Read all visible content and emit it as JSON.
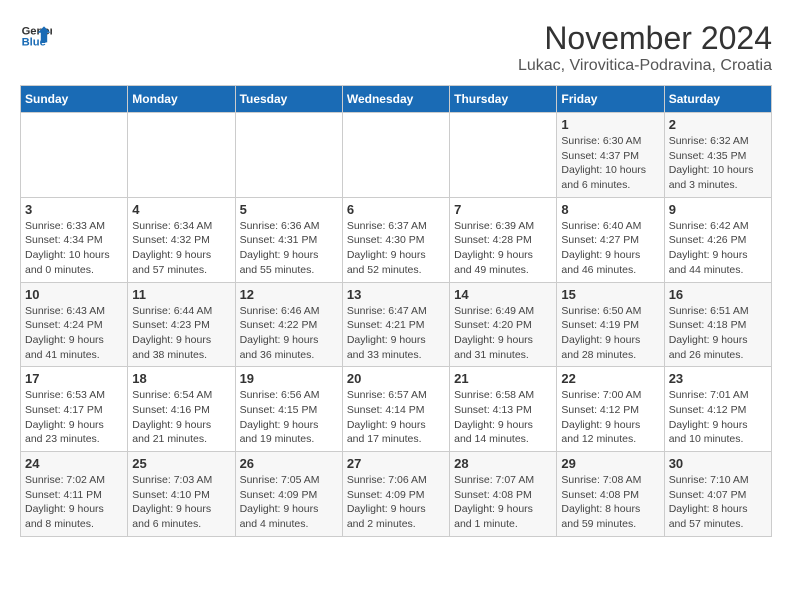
{
  "logo": {
    "line1": "General",
    "line2": "Blue"
  },
  "title": "November 2024",
  "subtitle": "Lukac, Virovitica-Podravina, Croatia",
  "weekdays": [
    "Sunday",
    "Monday",
    "Tuesday",
    "Wednesday",
    "Thursday",
    "Friday",
    "Saturday"
  ],
  "weeks": [
    [
      {
        "day": "",
        "info": ""
      },
      {
        "day": "",
        "info": ""
      },
      {
        "day": "",
        "info": ""
      },
      {
        "day": "",
        "info": ""
      },
      {
        "day": "",
        "info": ""
      },
      {
        "day": "1",
        "info": "Sunrise: 6:30 AM\nSunset: 4:37 PM\nDaylight: 10 hours\nand 6 minutes."
      },
      {
        "day": "2",
        "info": "Sunrise: 6:32 AM\nSunset: 4:35 PM\nDaylight: 10 hours\nand 3 minutes."
      }
    ],
    [
      {
        "day": "3",
        "info": "Sunrise: 6:33 AM\nSunset: 4:34 PM\nDaylight: 10 hours\nand 0 minutes."
      },
      {
        "day": "4",
        "info": "Sunrise: 6:34 AM\nSunset: 4:32 PM\nDaylight: 9 hours\nand 57 minutes."
      },
      {
        "day": "5",
        "info": "Sunrise: 6:36 AM\nSunset: 4:31 PM\nDaylight: 9 hours\nand 55 minutes."
      },
      {
        "day": "6",
        "info": "Sunrise: 6:37 AM\nSunset: 4:30 PM\nDaylight: 9 hours\nand 52 minutes."
      },
      {
        "day": "7",
        "info": "Sunrise: 6:39 AM\nSunset: 4:28 PM\nDaylight: 9 hours\nand 49 minutes."
      },
      {
        "day": "8",
        "info": "Sunrise: 6:40 AM\nSunset: 4:27 PM\nDaylight: 9 hours\nand 46 minutes."
      },
      {
        "day": "9",
        "info": "Sunrise: 6:42 AM\nSunset: 4:26 PM\nDaylight: 9 hours\nand 44 minutes."
      }
    ],
    [
      {
        "day": "10",
        "info": "Sunrise: 6:43 AM\nSunset: 4:24 PM\nDaylight: 9 hours\nand 41 minutes."
      },
      {
        "day": "11",
        "info": "Sunrise: 6:44 AM\nSunset: 4:23 PM\nDaylight: 9 hours\nand 38 minutes."
      },
      {
        "day": "12",
        "info": "Sunrise: 6:46 AM\nSunset: 4:22 PM\nDaylight: 9 hours\nand 36 minutes."
      },
      {
        "day": "13",
        "info": "Sunrise: 6:47 AM\nSunset: 4:21 PM\nDaylight: 9 hours\nand 33 minutes."
      },
      {
        "day": "14",
        "info": "Sunrise: 6:49 AM\nSunset: 4:20 PM\nDaylight: 9 hours\nand 31 minutes."
      },
      {
        "day": "15",
        "info": "Sunrise: 6:50 AM\nSunset: 4:19 PM\nDaylight: 9 hours\nand 28 minutes."
      },
      {
        "day": "16",
        "info": "Sunrise: 6:51 AM\nSunset: 4:18 PM\nDaylight: 9 hours\nand 26 minutes."
      }
    ],
    [
      {
        "day": "17",
        "info": "Sunrise: 6:53 AM\nSunset: 4:17 PM\nDaylight: 9 hours\nand 23 minutes."
      },
      {
        "day": "18",
        "info": "Sunrise: 6:54 AM\nSunset: 4:16 PM\nDaylight: 9 hours\nand 21 minutes."
      },
      {
        "day": "19",
        "info": "Sunrise: 6:56 AM\nSunset: 4:15 PM\nDaylight: 9 hours\nand 19 minutes."
      },
      {
        "day": "20",
        "info": "Sunrise: 6:57 AM\nSunset: 4:14 PM\nDaylight: 9 hours\nand 17 minutes."
      },
      {
        "day": "21",
        "info": "Sunrise: 6:58 AM\nSunset: 4:13 PM\nDaylight: 9 hours\nand 14 minutes."
      },
      {
        "day": "22",
        "info": "Sunrise: 7:00 AM\nSunset: 4:12 PM\nDaylight: 9 hours\nand 12 minutes."
      },
      {
        "day": "23",
        "info": "Sunrise: 7:01 AM\nSunset: 4:12 PM\nDaylight: 9 hours\nand 10 minutes."
      }
    ],
    [
      {
        "day": "24",
        "info": "Sunrise: 7:02 AM\nSunset: 4:11 PM\nDaylight: 9 hours\nand 8 minutes."
      },
      {
        "day": "25",
        "info": "Sunrise: 7:03 AM\nSunset: 4:10 PM\nDaylight: 9 hours\nand 6 minutes."
      },
      {
        "day": "26",
        "info": "Sunrise: 7:05 AM\nSunset: 4:09 PM\nDaylight: 9 hours\nand 4 minutes."
      },
      {
        "day": "27",
        "info": "Sunrise: 7:06 AM\nSunset: 4:09 PM\nDaylight: 9 hours\nand 2 minutes."
      },
      {
        "day": "28",
        "info": "Sunrise: 7:07 AM\nSunset: 4:08 PM\nDaylight: 9 hours\nand 1 minute."
      },
      {
        "day": "29",
        "info": "Sunrise: 7:08 AM\nSunset: 4:08 PM\nDaylight: 8 hours\nand 59 minutes."
      },
      {
        "day": "30",
        "info": "Sunrise: 7:10 AM\nSunset: 4:07 PM\nDaylight: 8 hours\nand 57 minutes."
      }
    ]
  ]
}
